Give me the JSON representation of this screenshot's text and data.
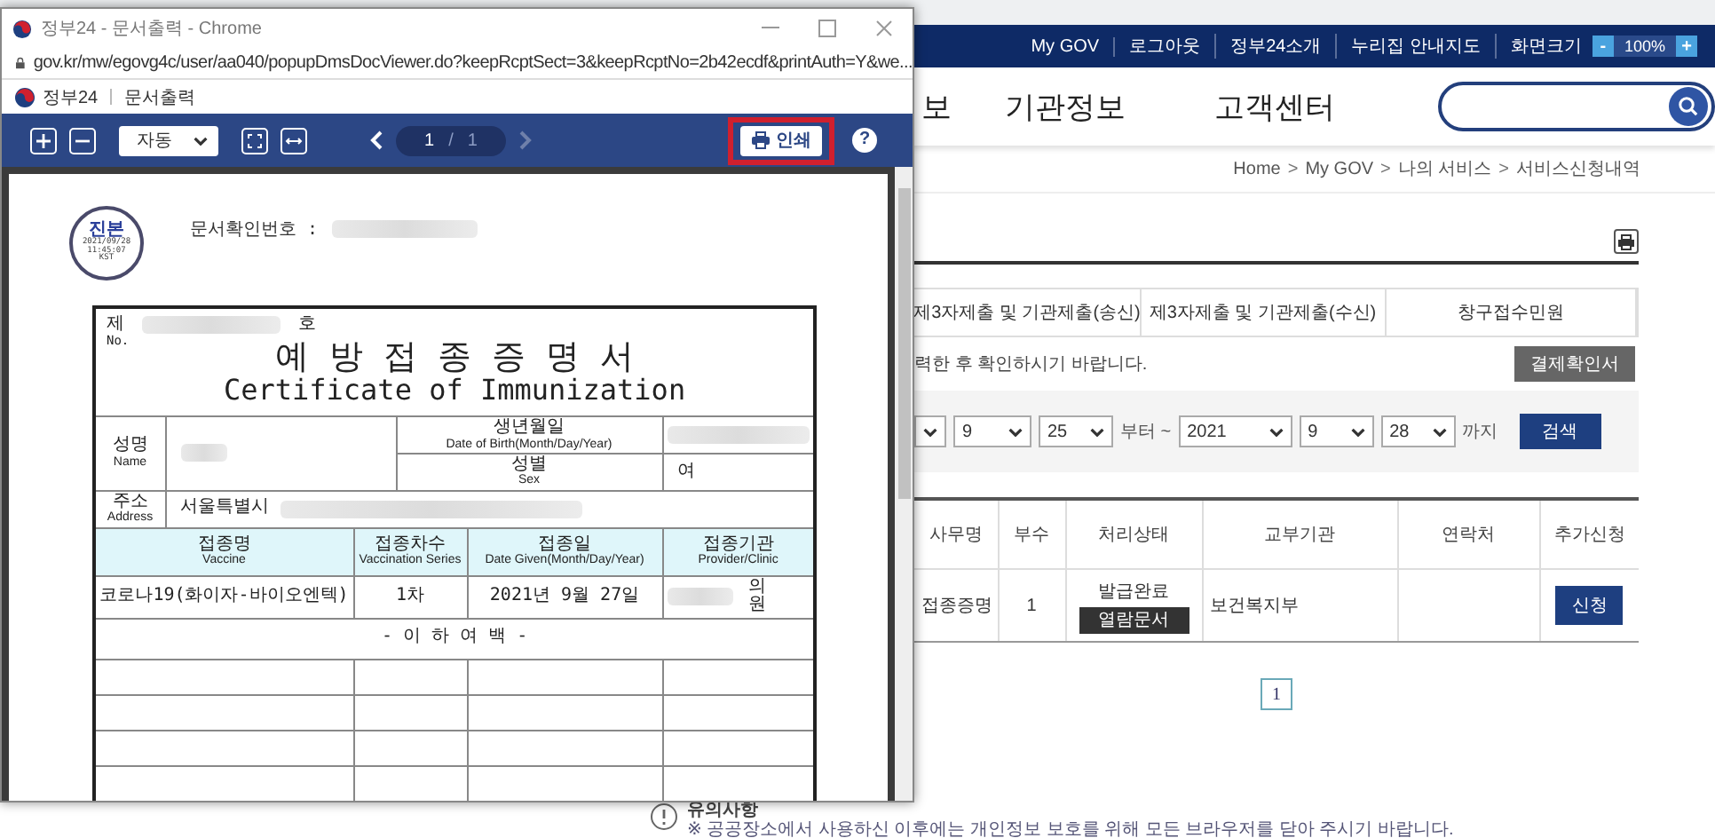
{
  "site": {
    "utility_links": [
      "My GOV",
      "로그아웃",
      "정부24소개",
      "누리집 안내지도"
    ],
    "font_size": {
      "label": "화면크기",
      "minus": "-",
      "value": "100%",
      "plus": "+"
    },
    "nav": [
      "보",
      "기관정보",
      "고객센터"
    ],
    "breadcrumb": [
      "Home",
      "My GOV",
      "나의 서비스",
      "서비스신청내역"
    ],
    "breadcrumb_separator": ">",
    "tabs": [
      {
        "label": "제3자제출 및 기관제출(송신)",
        "selected": false
      },
      {
        "label": "제3자제출 및 기관제출(수신)",
        "selected": false
      },
      {
        "label": "창구접수민원",
        "selected": false
      }
    ],
    "notice": "력한 후 확인하시기 바랍니다.",
    "confirm_button": "결제확인서",
    "date_filter": {
      "from": [
        "9",
        "25"
      ],
      "from_suffix": "부터 ~",
      "to": [
        "2021",
        "9",
        "28"
      ],
      "to_suffix": "까지",
      "search_button": "검색"
    },
    "table": {
      "columns": [
        "사무명",
        "부수",
        "처리상태",
        "교부기관",
        "연락처",
        "추가신청"
      ],
      "rows": [
        {
          "name": "접종증명",
          "copies": "1",
          "status": "발급완료",
          "view_button": "열람문서",
          "agency": "보건복지부",
          "apply_button": "신청"
        }
      ]
    },
    "pagination": [
      {
        "label": "1",
        "selected": true
      }
    ],
    "caution": {
      "title": "유의사항",
      "text": "※ 공공장소에서 사용하신 이후에는 개인정보 보호를 위해 모든 브라우저를 닫아 주시기 바랍니다."
    }
  },
  "popup": {
    "title": "정부24 - 문서출력 - Chrome",
    "url": "gov.kr/mw/egovg4c/user/aa040/popupDmsDocViewer.do?keepRcptSect=3&keepRcptNo=2b42ecdf&printAuth=Y&we...",
    "app_name": "정부24",
    "app_section": "문서출력",
    "zoom_select": "자동",
    "page": {
      "current": "1",
      "separator": "/",
      "total": "1"
    },
    "print_button": {
      "label": "인쇄",
      "highlighted": true
    },
    "help": "?",
    "document": {
      "seal": {
        "label": "진본",
        "date": "2021/09/28",
        "time": "11:45:07",
        "zone": "KST"
      },
      "doc_number_label": "문서확인번호 :",
      "number_prefix": "제",
      "number_label": "No.",
      "number_suffix": "호",
      "title_ko": "예 방 접 종 증 명 서",
      "title_en": "Certificate of Immunization",
      "name": {
        "ko": "성명",
        "en": "Name"
      },
      "birth": {
        "ko": "생년월일",
        "en": "Date of Birth(Month/Day/Year)"
      },
      "sex": {
        "ko": "성별",
        "en": "Sex",
        "value": "여"
      },
      "address": {
        "ko": "주소",
        "en": "Address",
        "value": "서울특별시"
      },
      "vaccination_columns": [
        {
          "ko": "접종명",
          "en": "Vaccine"
        },
        {
          "ko": "접종차수",
          "en": "Vaccination Series"
        },
        {
          "ko": "접종일",
          "en": "Date Given(Month/Day/Year)"
        },
        {
          "ko": "접종기관",
          "en": "Provider/Clinic"
        }
      ],
      "vaccinations": [
        {
          "vaccine": "코로나19(화이자-바이오엔텍)",
          "series": "1차",
          "date": "2021년 9월 27일",
          "provider": "의원"
        }
      ],
      "end_mark": "- 이 하 여 백 -"
    }
  }
}
